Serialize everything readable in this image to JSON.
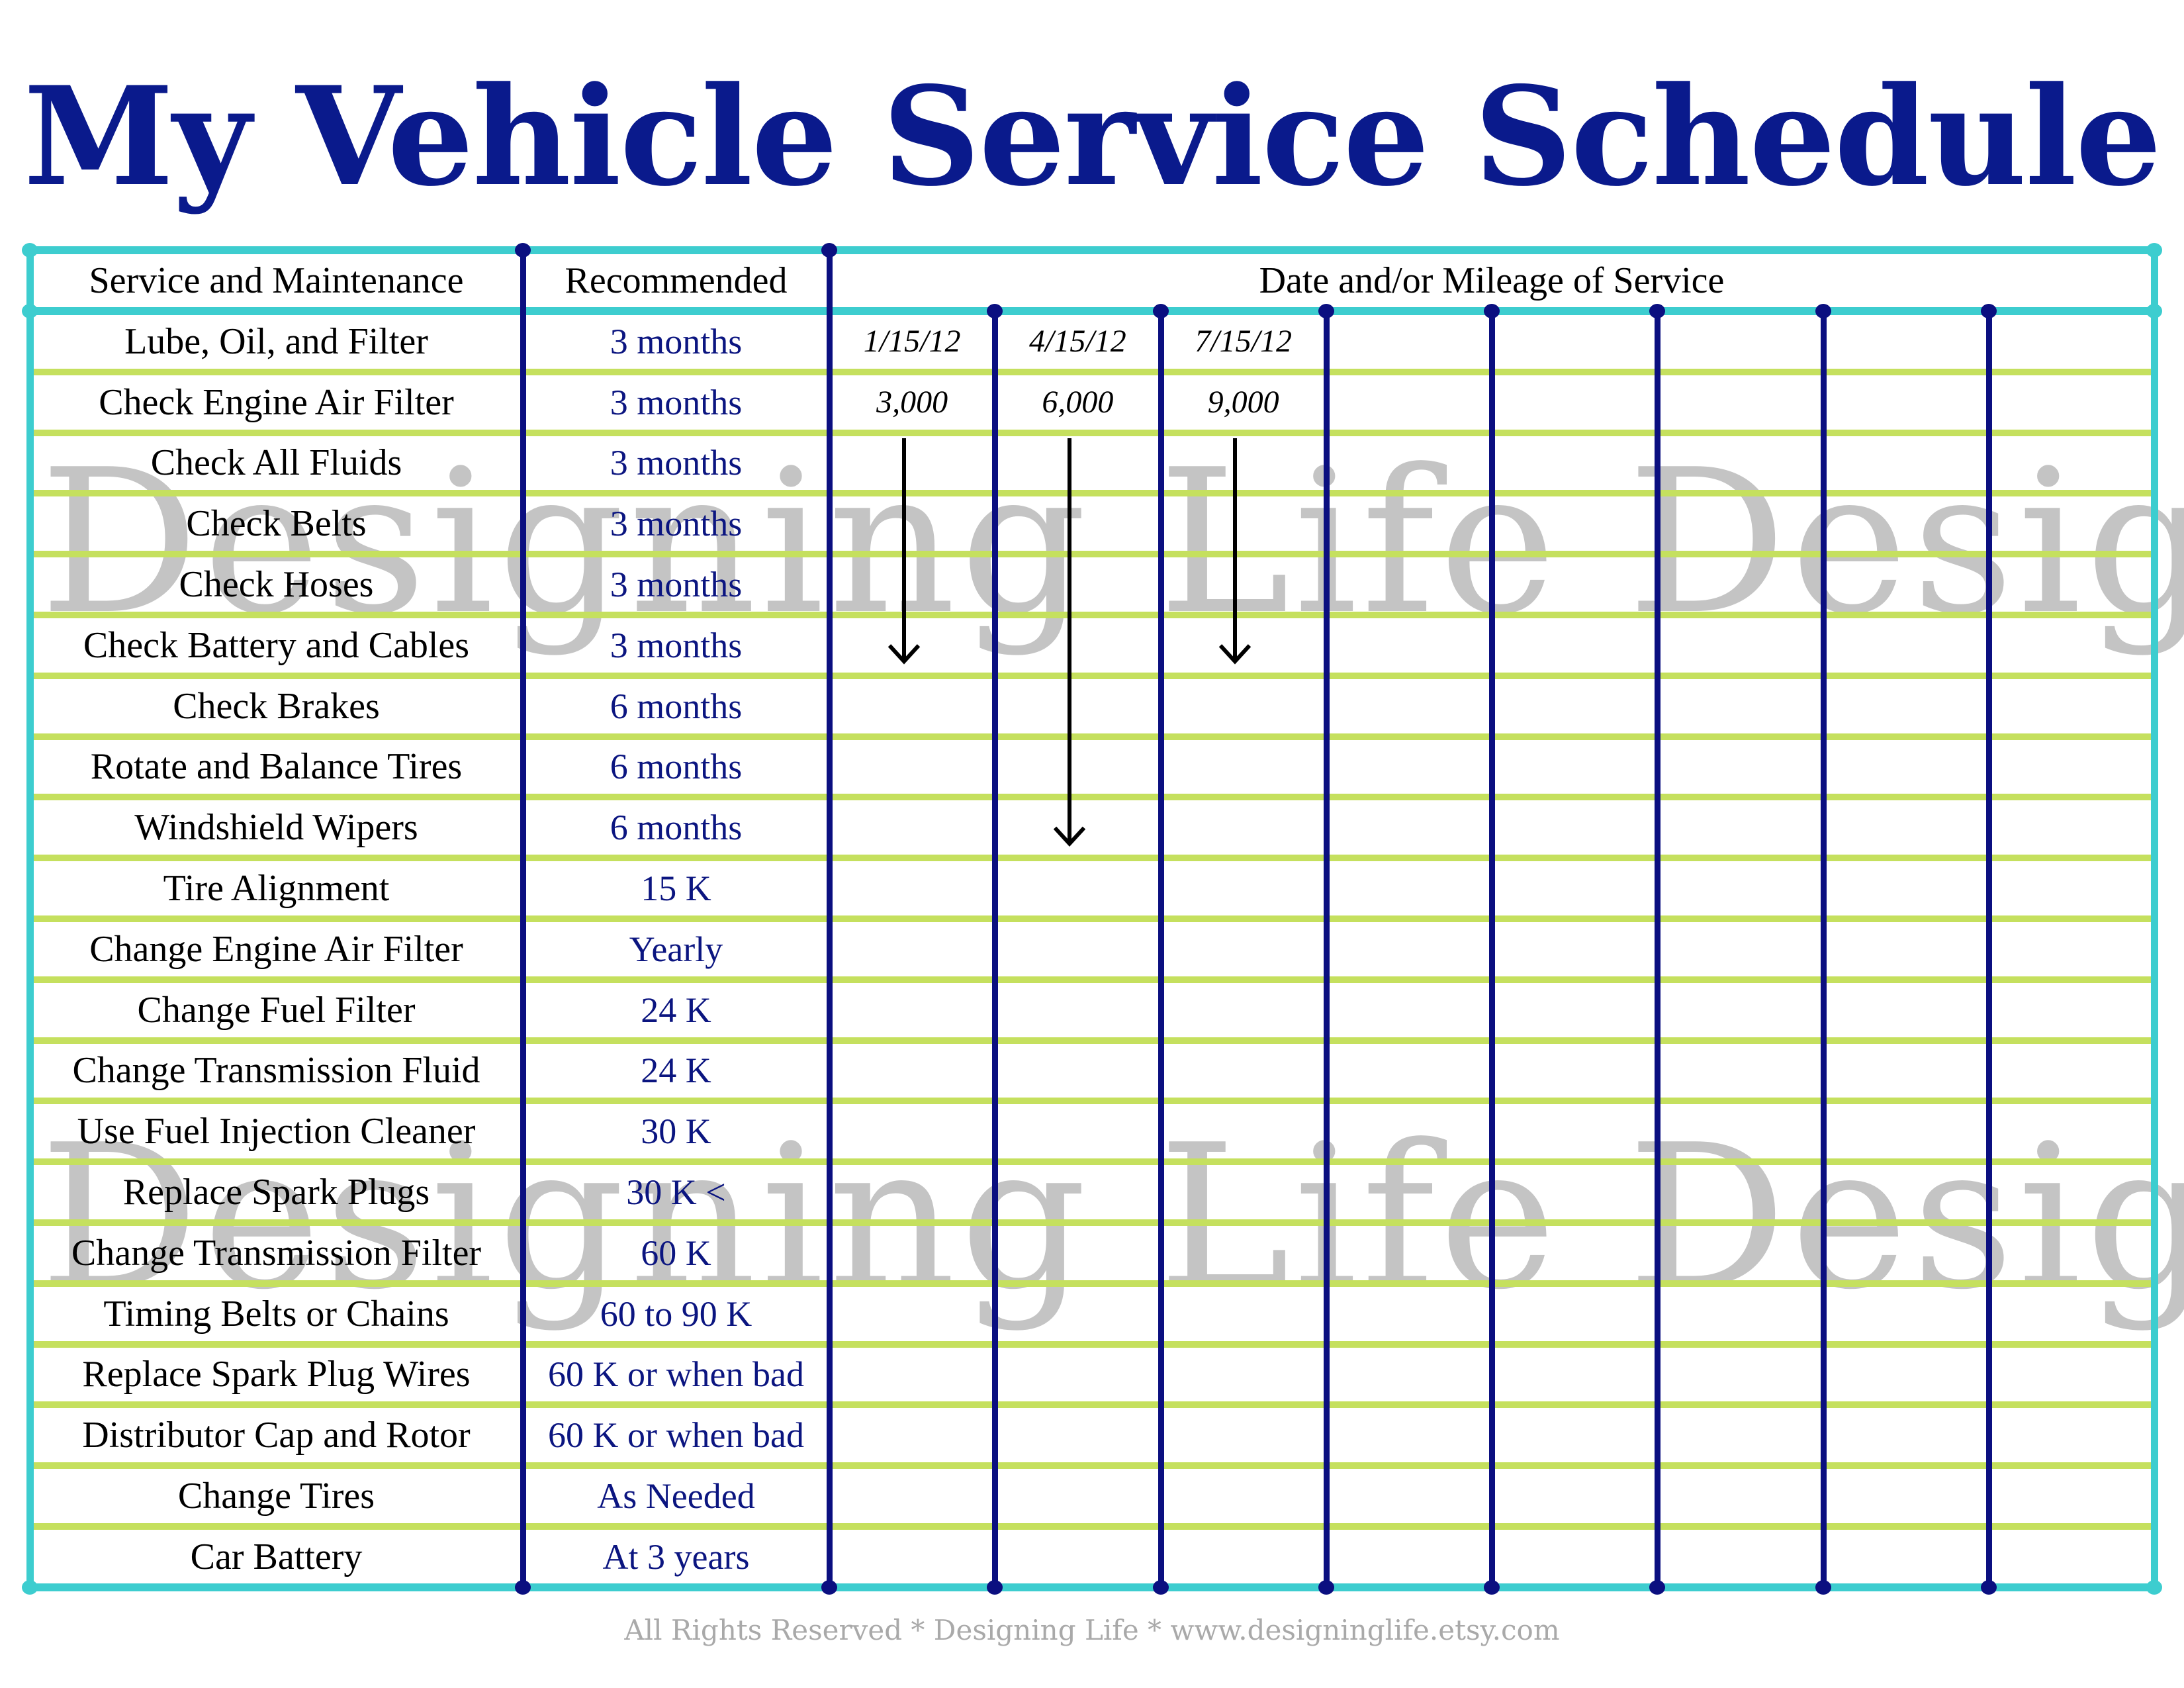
{
  "title": "My Vehicle Service Schedule",
  "watermark": "Designing Life Designs",
  "header": {
    "service": "Service and Maintenance",
    "recommended": "Recommended",
    "dates": "Date and/or Mileage of Service"
  },
  "rows": [
    {
      "service": "Lube, Oil, and Filter",
      "recommended": "3  months"
    },
    {
      "service": "Check Engine Air Filter",
      "recommended": "3 months"
    },
    {
      "service": "Check All Fluids",
      "recommended": "3 months"
    },
    {
      "service": "Check Belts",
      "recommended": "3 months"
    },
    {
      "service": "Check Hoses",
      "recommended": "3 months"
    },
    {
      "service": "Check Battery and Cables",
      "recommended": "3 months"
    },
    {
      "service": "Check Brakes",
      "recommended": "6 months"
    },
    {
      "service": "Rotate and Balance Tires",
      "recommended": "6 months"
    },
    {
      "service": "Windshield Wipers",
      "recommended": "6 months"
    },
    {
      "service": "Tire Alignment",
      "recommended": "15 K"
    },
    {
      "service": "Change Engine Air Filter",
      "recommended": "Yearly"
    },
    {
      "service": "Change Fuel Filter",
      "recommended": "24 K"
    },
    {
      "service": "Change Transmission Fluid",
      "recommended": "24 K"
    },
    {
      "service": "Use Fuel Injection Cleaner",
      "recommended": "30 K"
    },
    {
      "service": "Replace Spark Plugs",
      "recommended": "30 K <"
    },
    {
      "service": "Change Transmission Filter",
      "recommended": "60 K"
    },
    {
      "service": "Timing Belts or Chains",
      "recommended": "60 to 90 K"
    },
    {
      "service": "Replace Spark Plug Wires",
      "recommended": "60 K or when bad"
    },
    {
      "service": "Distributor Cap and Rotor",
      "recommended": "60 K or when bad"
    },
    {
      "service": "Change Tires",
      "recommended": "As Needed"
    },
    {
      "service": "Car Battery",
      "recommended": "At 3 years"
    }
  ],
  "date_columns": 8,
  "entries": [
    {
      "column": 0,
      "date": "1/15/12",
      "mileage": "3,000",
      "arrow_last_row": 5
    },
    {
      "column": 1,
      "date": "4/15/12",
      "mileage": "6,000",
      "arrow_last_row": 8
    },
    {
      "column": 2,
      "date": "7/15/12",
      "mileage": "9,000",
      "arrow_last_row": 5
    }
  ],
  "footer": "All Rights Reserved * Designing Life * www.designinglife.etsy.com",
  "colors": {
    "title": "#0a1a8c",
    "navy_lines": "#0b0f80",
    "teal_border": "#3dcdcf",
    "green_rules": "#c5e05e",
    "watermark": "#c4c4c4"
  }
}
